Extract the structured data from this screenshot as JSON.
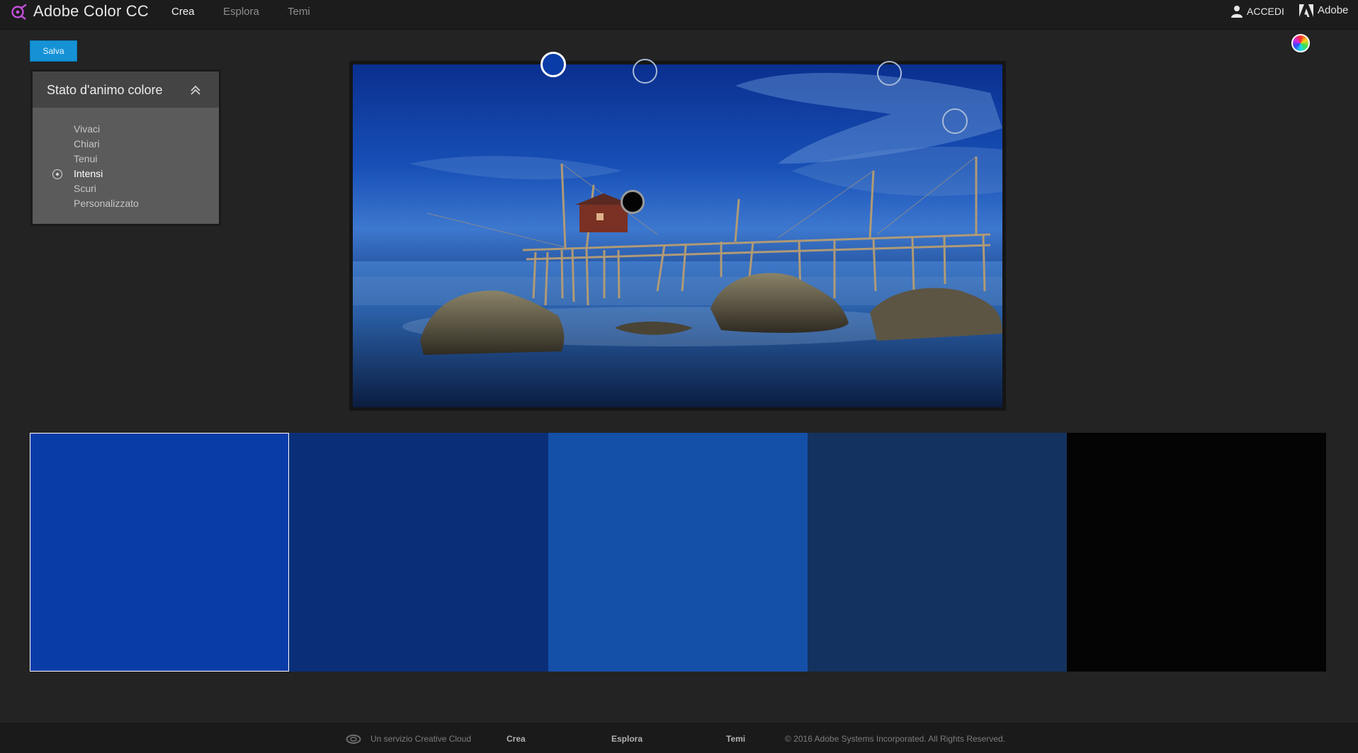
{
  "app": {
    "title": "Adobe Color CC"
  },
  "nav": {
    "items": [
      "Crea",
      "Esplora",
      "Temi"
    ],
    "active": "Crea"
  },
  "account": {
    "signin_label": "ACCEDI",
    "adobe_label": "Adobe"
  },
  "toolbar": {
    "save_label": "Salva"
  },
  "mood": {
    "title": "Stato d'animo colore",
    "options": [
      "Vivaci",
      "Chiari",
      "Tenui",
      "Intensi",
      "Scuri",
      "Personalizzato"
    ],
    "selected": "Intensi"
  },
  "palette": {
    "swatches": [
      "#0A3CA8",
      "#0A2F78",
      "#1550A8",
      "#13325F",
      "#040404"
    ],
    "selected_index": 0
  },
  "footer": {
    "tagline": "Un servizio Creative Cloud",
    "links": [
      "Crea",
      "Esplora",
      "Temi"
    ],
    "copyright": "© 2016 Adobe Systems Incorporated. All Rights Reserved."
  }
}
